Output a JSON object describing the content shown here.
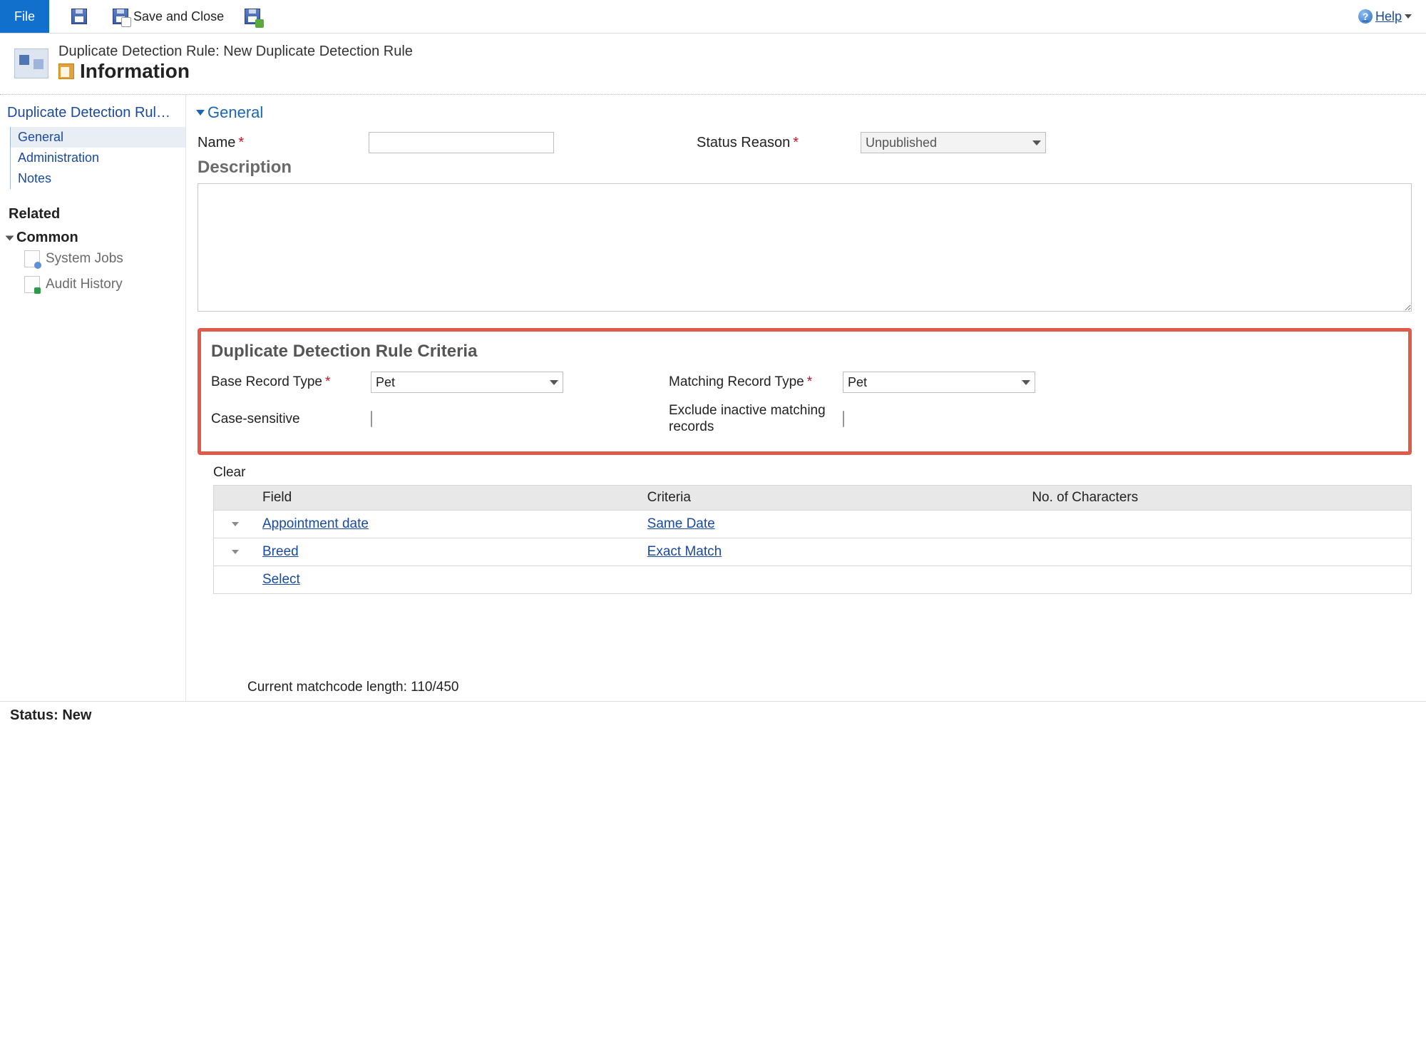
{
  "toolbar": {
    "file_label": "File",
    "save_close_label": "Save and Close",
    "help_label": "Help"
  },
  "header": {
    "entity_line": "Duplicate Detection Rule: New Duplicate Detection Rule",
    "page_title": "Information"
  },
  "leftnav": {
    "root_label": "Duplicate Detection Rule : ...",
    "links": [
      "General",
      "Administration",
      "Notes"
    ],
    "related_label": "Related",
    "common_label": "Common",
    "common_items": [
      "System Jobs",
      "Audit History"
    ]
  },
  "form": {
    "section_label": "General",
    "name_label": "Name",
    "name_value": "",
    "status_reason_label": "Status Reason",
    "status_reason_value": "Unpublished",
    "description_label": "Description",
    "description_value": ""
  },
  "criteria": {
    "block_title": "Duplicate Detection Rule Criteria",
    "base_type_label": "Base Record Type",
    "base_type_value": "Pet",
    "matching_type_label": "Matching Record Type",
    "matching_type_value": "Pet",
    "case_sensitive_label": "Case-sensitive",
    "case_sensitive_value": false,
    "exclude_inactive_label": "Exclude inactive matching records",
    "exclude_inactive_value": false
  },
  "table": {
    "clear_label": "Clear",
    "col_field": "Field",
    "col_criteria": "Criteria",
    "col_chars": "No. of Characters",
    "rows": [
      {
        "field": "Appointment date",
        "criteria": "Same Date",
        "chars": ""
      },
      {
        "field": "Breed",
        "criteria": "Exact Match",
        "chars": ""
      }
    ],
    "select_label": "Select"
  },
  "matchcode_text": "Current matchcode length: 110/450",
  "status_bar": "Status: New"
}
